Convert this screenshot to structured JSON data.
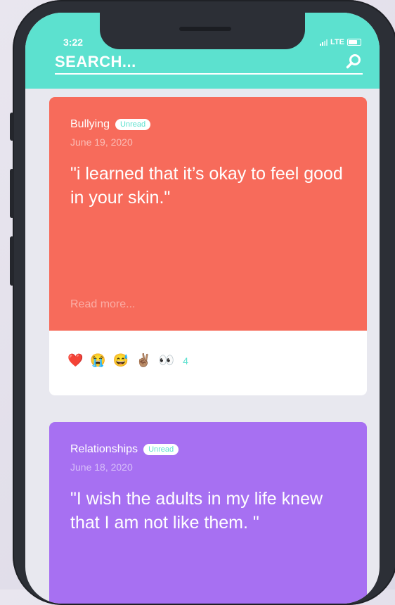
{
  "status_bar": {
    "time": "3:22",
    "network": "LTE"
  },
  "search": {
    "placeholder": "SEARCH..."
  },
  "cards": [
    {
      "category": "Bullying",
      "badge": "Unread",
      "date": "June 19, 2020",
      "quote": "\"i learned that it’s okay to feel good in your skin.\"",
      "read_more": "Read more...",
      "reactions": [
        "❤️",
        "😭",
        "😅",
        "✌🏽",
        "👀"
      ],
      "reaction_count": "4",
      "color": "#f76b5b"
    },
    {
      "category": "Relationships",
      "badge": "Unread",
      "date": "June 18, 2020",
      "quote": "\"I wish the adults in my life knew that I am not like them. \"",
      "color": "#a770f2"
    }
  ],
  "colors": {
    "accent": "#5ce1cf",
    "background": "#e8e8ef"
  }
}
